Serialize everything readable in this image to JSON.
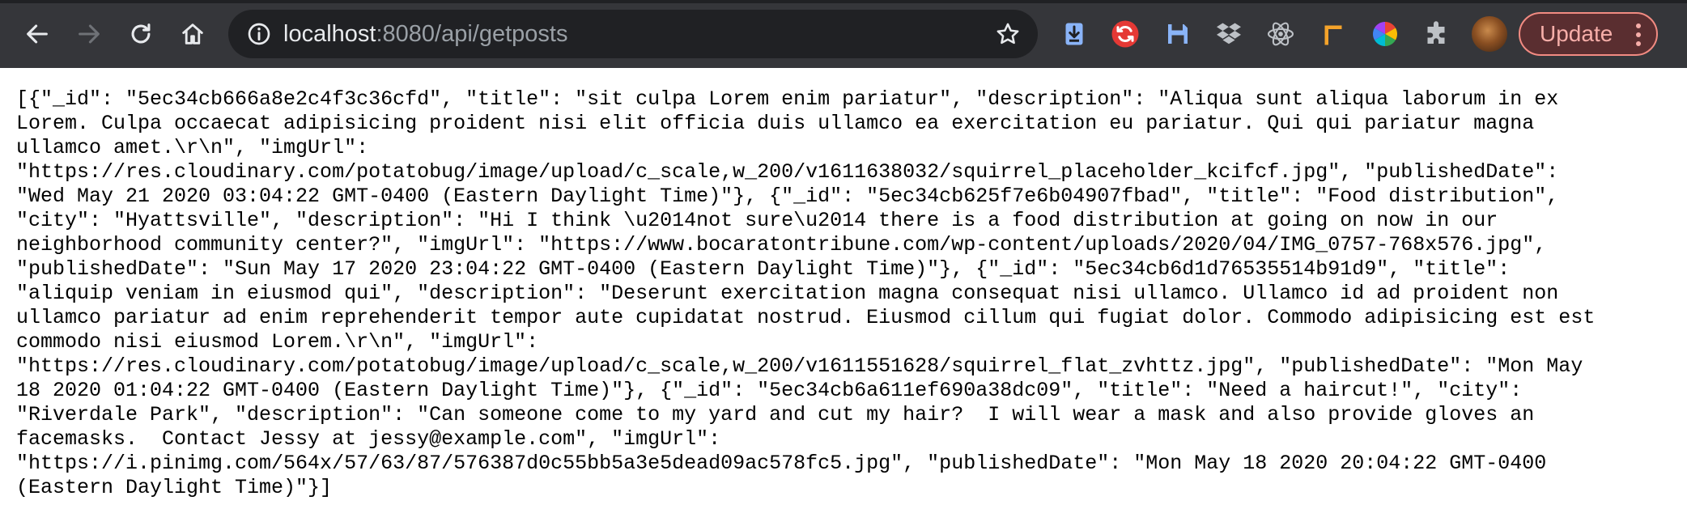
{
  "browser": {
    "url_host": "localhost",
    "url_rest": ":8080/api/getposts",
    "update_label": "Update",
    "extensions": [
      "downloader-icon",
      "sync-icon",
      "floppy-disk-icon",
      "dropbox-icon",
      "react-icon",
      "ruler-icon",
      "color-wheel-icon",
      "puzzle-piece-icon"
    ],
    "colors": {
      "toolbar": "#35363a",
      "omnibox": "#202124",
      "update_border": "#f28b82",
      "update_text": "#f6aea9"
    }
  },
  "response_lines": [
    "[{\"_id\": \"5ec34cb666a8e2c4f3c36cfd\", \"title\": \"sit culpa Lorem enim pariatur\", \"description\": \"Aliqua sunt aliqua laborum in ex",
    "Lorem. Culpa occaecat adipisicing proident nisi elit officia duis ullamco ea exercitation eu pariatur. Qui qui pariatur magna",
    "ullamco amet.\\r\\n\", \"imgUrl\":",
    "\"https://res.cloudinary.com/potatobug/image/upload/c_scale,w_200/v1611638032/squirrel_placeholder_kcifcf.jpg\", \"publishedDate\":",
    "\"Wed May 21 2020 03:04:22 GMT-0400 (Eastern Daylight Time)\"}, {\"_id\": \"5ec34cb625f7e6b04907fbad\", \"title\": \"Food distribution\",",
    "\"city\": \"Hyattsville\", \"description\": \"Hi I think \\u2014not sure\\u2014 there is a food distribution at going on now in our",
    "neighborhood community center?\", \"imgUrl\": \"https://www.bocaratontribune.com/wp-content/uploads/2020/04/IMG_0757-768x576.jpg\",",
    "\"publishedDate\": \"Sun May 17 2020 23:04:22 GMT-0400 (Eastern Daylight Time)\"}, {\"_id\": \"5ec34cb6d1d76535514b91d9\", \"title\":",
    "\"aliquip veniam in eiusmod qui\", \"description\": \"Deserunt exercitation magna consequat nisi ullamco. Ullamco id ad proident non",
    "ullamco pariatur ad enim reprehenderit tempor aute cupidatat nostrud. Eiusmod cillum qui fugiat dolor. Commodo adipisicing est est",
    "commodo nisi eiusmod Lorem.\\r\\n\", \"imgUrl\":",
    "\"https://res.cloudinary.com/potatobug/image/upload/c_scale,w_200/v1611551628/squirrel_flat_zvhttz.jpg\", \"publishedDate\": \"Mon May",
    "18 2020 01:04:22 GMT-0400 (Eastern Daylight Time)\"}, {\"_id\": \"5ec34cb6a611ef690a38dc09\", \"title\": \"Need a haircut!\", \"city\":",
    "\"Riverdale Park\", \"description\": \"Can someone come to my yard and cut my hair?  I will wear a mask and also provide gloves an",
    "facemasks.  Contact Jessy at jessy@example.com\", \"imgUrl\":",
    "\"https://i.pinimg.com/564x/57/63/87/576387d0c55bb5a3e5dead09ac578fc5.jpg\", \"publishedDate\": \"Mon May 18 2020 20:04:22 GMT-0400",
    "(Eastern Daylight Time)\"}]"
  ]
}
